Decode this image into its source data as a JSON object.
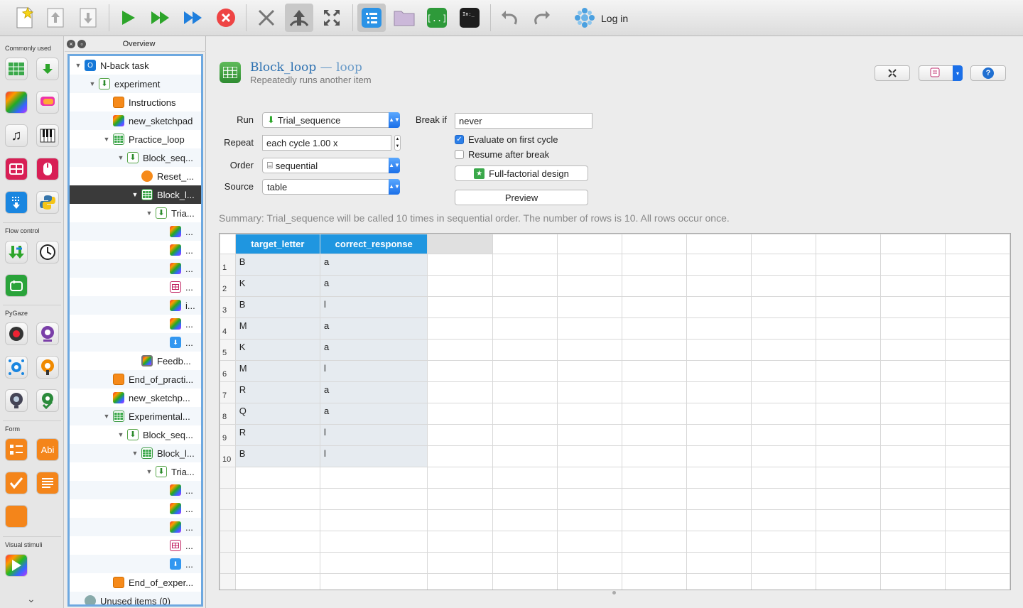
{
  "toolbar": {
    "login_label": "Log in",
    "buttons": [
      "new-file",
      "open-up",
      "open-down",
      "run",
      "run-quick",
      "run-fast",
      "stop",
      "kill",
      "compile",
      "fullscreen",
      "overview",
      "file-pool",
      "variable-inspector",
      "debug-window",
      "undo",
      "redo"
    ]
  },
  "toolbox": {
    "sections": [
      "Commonly used",
      "Flow control",
      "PyGaze",
      "Form",
      "Visual stimuli"
    ]
  },
  "overview": {
    "title": "Overview",
    "nodes": [
      {
        "label": "N-back task"
      },
      {
        "label": "experiment"
      },
      {
        "label": "Instructions"
      },
      {
        "label": "new_sketchpad"
      },
      {
        "label": "Practice_loop"
      },
      {
        "label": "Block_seq..."
      },
      {
        "label": "Reset_..."
      },
      {
        "label": "Block_l..."
      },
      {
        "label": "Tria..."
      },
      {
        "label": "..."
      },
      {
        "label": "..."
      },
      {
        "label": "..."
      },
      {
        "label": "..."
      },
      {
        "label": "i..."
      },
      {
        "label": "..."
      },
      {
        "label": "..."
      },
      {
        "label": "Feedb..."
      },
      {
        "label": "End_of_practi..."
      },
      {
        "label": "new_sketchp..."
      },
      {
        "label": "Experimental..."
      },
      {
        "label": "Block_seq..."
      },
      {
        "label": "Block_l..."
      },
      {
        "label": "Tria..."
      },
      {
        "label": "..."
      },
      {
        "label": "..."
      },
      {
        "label": "..."
      },
      {
        "label": "..."
      },
      {
        "label": "..."
      },
      {
        "label": "End_of_exper..."
      },
      {
        "label": "Unused items (0)"
      }
    ]
  },
  "header": {
    "title": "Block_loop",
    "type": " — loop",
    "subtitle": "Repeatedly runs another item"
  },
  "form": {
    "run_label": "Run",
    "run_value": "Trial_sequence",
    "repeat_label": "Repeat",
    "repeat_value": "each cycle 1.00 x",
    "order_label": "Order",
    "order_value": "sequential",
    "source_label": "Source",
    "source_value": "table",
    "break_label": "Break if",
    "break_value": "never",
    "eval_first_label": "Evaluate on first cycle",
    "eval_first_checked": true,
    "resume_label": "Resume after break",
    "resume_checked": false,
    "factorial_label": "Full-factorial design",
    "preview_label": "Preview"
  },
  "summary": "Summary: Trial_sequence will be called 10 times in sequential order. The number of rows is 10. All rows occur once.",
  "table": {
    "columns": [
      "target_letter",
      "correct_response"
    ],
    "rows": [
      [
        "B",
        "a"
      ],
      [
        "K",
        "a"
      ],
      [
        "B",
        "l"
      ],
      [
        "M",
        "a"
      ],
      [
        "K",
        "a"
      ],
      [
        "M",
        "l"
      ],
      [
        "R",
        "a"
      ],
      [
        "Q",
        "a"
      ],
      [
        "R",
        "l"
      ],
      [
        "B",
        "l"
      ]
    ]
  }
}
